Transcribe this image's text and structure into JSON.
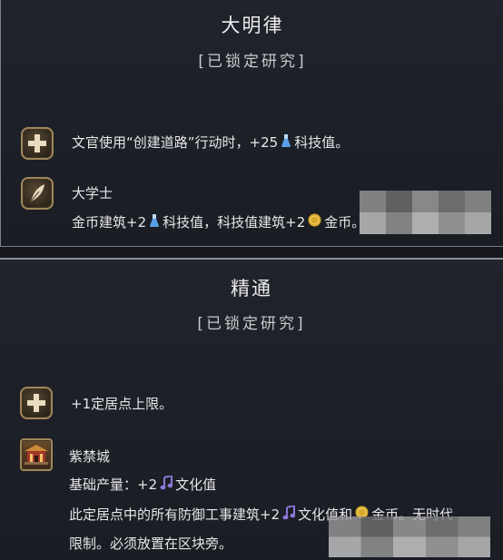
{
  "card1": {
    "title": "大明律",
    "status": "[已锁定研究]",
    "effect1": {
      "icon": "plus-icon",
      "text_a": "文官使用“创建道路”行动时，+25",
      "resource_icon": "science-flask-icon",
      "text_b": "科技值。"
    },
    "effect2": {
      "icon": "quill-icon",
      "name": "大学士",
      "text_a": "金币建筑+2",
      "res1_icon": "science-flask-icon",
      "text_b": "科技值，科技值建筑+2",
      "res2_icon": "gold-coin-icon",
      "text_c": "金币。"
    }
  },
  "card2": {
    "title": "精通",
    "status": "[已锁定研究]",
    "effect1": {
      "icon": "plus-icon",
      "text": "+1定居点上限。"
    },
    "effect2": {
      "icon": "forbidden-city-icon",
      "name": "紫禁城",
      "line1_a": "基础产量：+2",
      "line1_icon": "culture-note-icon",
      "line1_b": "文化值",
      "line2_a": "此定居点中的所有防御工事建筑+2",
      "line2_icon1": "culture-note-icon",
      "line2_b": "文化值和",
      "line2_icon2": "gold-coin-icon",
      "line2_c": "金币。无时代",
      "line3": "限制。必须放置在区块旁。"
    }
  },
  "colors": {
    "background": "#1d2027",
    "badge_border": "#a08659",
    "science": "#5aa0e6",
    "gold": "#d6a928",
    "culture": "#8c78d8"
  }
}
